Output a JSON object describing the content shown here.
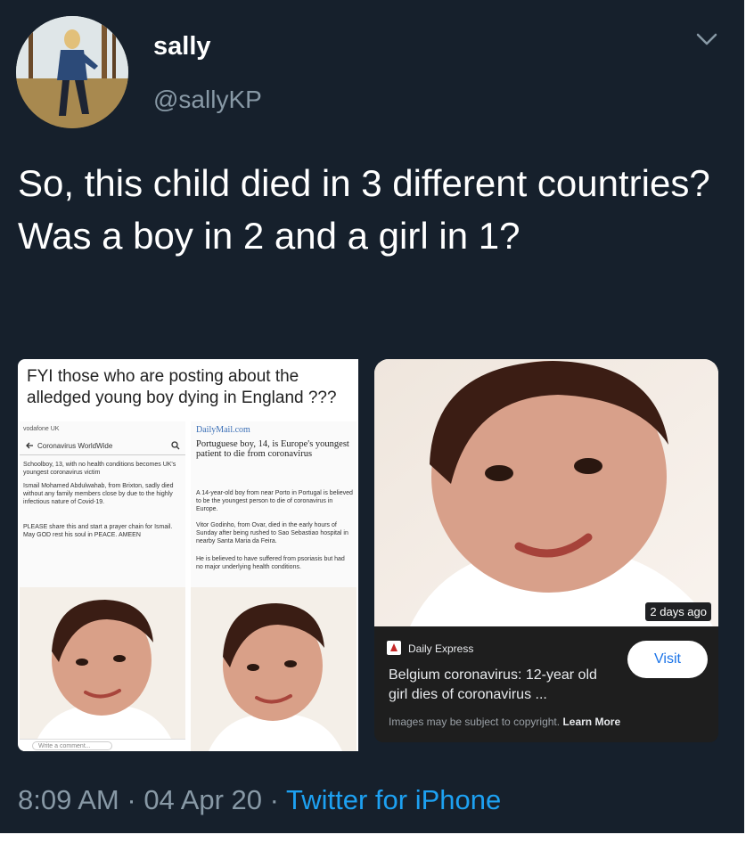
{
  "user": {
    "name": "sally",
    "handle": "@sallyKP"
  },
  "icons": {
    "menu": "chevron-down-icon",
    "source": "daily-express-icon",
    "search": "search-icon",
    "back": "arrow-left-icon"
  },
  "tweet": {
    "text": "So, this child died in 3 different countries? Was a boy in 2 and a girl in 1?"
  },
  "left_card": {
    "caption": "FYI those who are posting about the alledged young boy dying in England ???",
    "shot1": {
      "status_left": "vodafone UK",
      "header": "Coronavirus WorldWide",
      "p1": "Schoolboy, 13, with no health conditions becomes UK's youngest coronavirus victim",
      "p2": "Ismail Mohamed Abdulwahab, from Brixton, sadly died without any family members close by due to the highly infectious nature of Covid-19.",
      "p3": "PLEASE share this and start a prayer chain for Ismail. May GOD rest his soul in PEACE. AMEEN",
      "comment": "Write a comment..."
    },
    "shot2": {
      "site": "DailyMail.com",
      "headline": "Portuguese boy, 14, is Europe's youngest patient to die from coronavirus",
      "p1": "A 14-year-old boy from near Porto in Portugal is believed to be the youngest person to die of coronavirus in Europe.",
      "p2": "Vitor Godinho, from Ovar, died in the early hours of Sunday after being rushed to Sao Sebastiao hospital in nearby Santa Maria da Feira.",
      "p3": "He is believed to have suffered from psoriasis but had no major underlying health conditions."
    }
  },
  "right_card": {
    "age_badge": "2 days ago",
    "source": "Daily Express",
    "headline": "Belgium coronavirus: 12-year old girl dies of coronavirus ...",
    "visit_label": "Visit",
    "copyright": "Images may be subject to copyright.",
    "learn_more": "Learn More"
  },
  "footer": {
    "time": "8:09 AM",
    "sep1": " · ",
    "date": "04 Apr 20",
    "sep2": " · ",
    "via": "Twitter for iPhone"
  },
  "colors": {
    "background": "#16202c",
    "link": "#1da1f2",
    "secondary_text": "#8899a6"
  }
}
